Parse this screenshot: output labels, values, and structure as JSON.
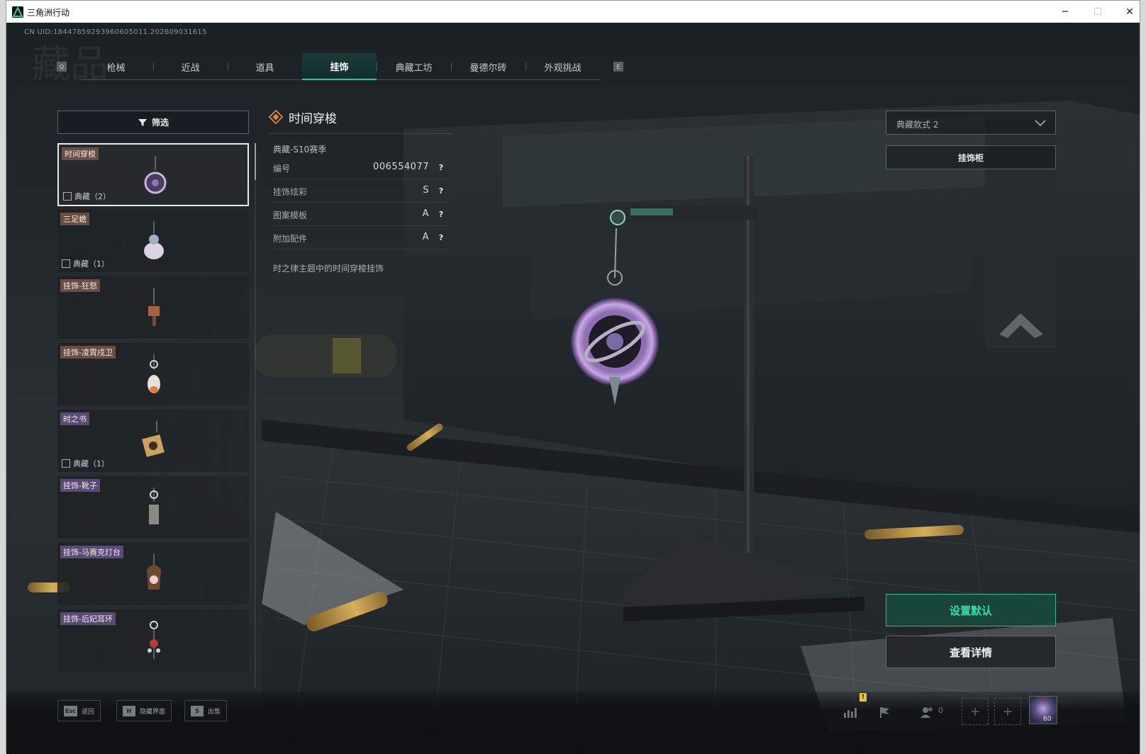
{
  "window": {
    "title": "三角洲行动",
    "minimize": "─",
    "maximize": "☐",
    "close": "✕"
  },
  "uid": "CN UID:18447859293960605011.202609031615",
  "watermark": "藏品",
  "tabs": [
    {
      "label": "枪械"
    },
    {
      "label": "近战"
    },
    {
      "label": "道具"
    },
    {
      "label": "挂饰"
    },
    {
      "label": "典藏工坊"
    },
    {
      "label": "曼德尔砖"
    },
    {
      "label": "外观挑战"
    }
  ],
  "tab_hints": {
    "prev": "Q",
    "next": "E"
  },
  "filter": {
    "label": "筛选"
  },
  "items": [
    {
      "name": "时间穿梭",
      "collection": "典藏（2）",
      "selected": true,
      "tag": "orange"
    },
    {
      "name": "三足蟾",
      "collection": "典藏（1）",
      "selected": false,
      "tag": "orange"
    },
    {
      "name": "挂饰-狂怒",
      "collection": "",
      "selected": false,
      "tag": "orange"
    },
    {
      "name": "挂饰-凌霄戍卫",
      "collection": "",
      "selected": false,
      "tag": "orange"
    },
    {
      "name": "时之书",
      "collection": "典藏（1）",
      "selected": false,
      "tag": "purple"
    },
    {
      "name": "挂饰-靴子",
      "collection": "",
      "selected": false,
      "tag": "purple"
    },
    {
      "name": "挂饰-马赛克灯台",
      "collection": "",
      "selected": false,
      "tag": "purple"
    },
    {
      "name": "挂饰-后妃耳环",
      "collection": "",
      "selected": false,
      "tag": "purple"
    }
  ],
  "detail": {
    "title": "时间穿梭",
    "season": "典藏-S10赛季",
    "props": [
      {
        "label": "编号",
        "value": "006554077"
      },
      {
        "label": "挂饰炫彩",
        "value": "S"
      },
      {
        "label": "图案模板",
        "value": "A"
      },
      {
        "label": "附加配件",
        "value": "A"
      }
    ],
    "help": "?",
    "description": "时之律主题中的时间穿梭挂饰"
  },
  "style_select": {
    "value": "典藏款式 2"
  },
  "cabinet_button": "挂饰柜",
  "set_default_button": "设置默认",
  "view_details_button": "查看详情",
  "hotkeys": [
    {
      "key": "Esc",
      "label": "返回"
    },
    {
      "key": "H",
      "label": "隐藏界面"
    },
    {
      "key": "S",
      "label": "出售"
    }
  ],
  "tray": {
    "warning": "!",
    "friend_count": "0",
    "add": "+",
    "avatar_level": "60"
  },
  "colors": {
    "accent_green": "#34e0a5",
    "tag_orange": "#6a4c42",
    "tag_purple": "#5a4a74",
    "background": "#22272a"
  }
}
